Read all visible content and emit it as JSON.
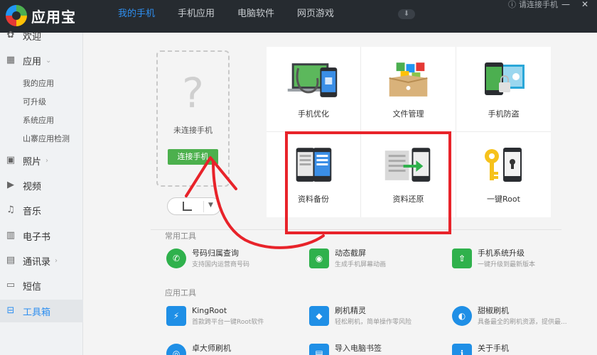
{
  "app": {
    "name": "应用宝"
  },
  "nav": {
    "tabs": [
      "我的手机",
      "手机应用",
      "电脑软件",
      "网页游戏"
    ],
    "active": 0,
    "download_icon": "download-icon"
  },
  "header_right": {
    "connect_status": "请连接手机",
    "minimize": "—",
    "close": "✕"
  },
  "sidebar": {
    "welcome": "欢迎",
    "apps": "应用",
    "app_subs": [
      "我的应用",
      "可升级",
      "系统应用",
      "山寨应用检测"
    ],
    "photos": "照片",
    "video": "视频",
    "music": "音乐",
    "ebook": "电子书",
    "contacts": "通讯录",
    "sms": "短信",
    "toolbox": "工具箱"
  },
  "phone": {
    "placeholder": "?",
    "status": "未连接手机",
    "connect_button": "连接手机"
  },
  "tiles": [
    {
      "label": "手机优化",
      "icon": "stethoscope-phone-icon"
    },
    {
      "label": "文件管理",
      "icon": "file-box-icon"
    },
    {
      "label": "手机防盗",
      "icon": "phone-lock-icon"
    },
    {
      "label": "资料备份",
      "icon": "backup-phones-icon"
    },
    {
      "label": "资料还原",
      "icon": "restore-arrow-icon"
    },
    {
      "label": "一键Root",
      "icon": "key-lock-phone-icon"
    }
  ],
  "common_tools": {
    "title": "常用工具",
    "items": [
      {
        "name": "号码归属查询",
        "desc": "支持国内运营商号码",
        "color": "#2fb14c"
      },
      {
        "name": "动态截屏",
        "desc": "生成手机屏幕动画",
        "color": "#2fb14c"
      },
      {
        "name": "手机系统升级",
        "desc": "一键升级到最新版本",
        "color": "#2fb14c"
      }
    ]
  },
  "app_tools": {
    "title": "应用工具",
    "items": [
      {
        "name": "KingRoot",
        "desc": "首款跨平台一键Root软件",
        "color": "#1f8fe6"
      },
      {
        "name": "刷机精灵",
        "desc": "轻松刷机，简单操作零风险",
        "color": "#1f8fe6"
      },
      {
        "name": "甜椒刷机",
        "desc": "具备最全的刷机资源，提供最...",
        "color": "#1f8fe6"
      },
      {
        "name": "卓大师刷机",
        "desc": "",
        "color": "#1f8fe6"
      },
      {
        "name": "导入电脑书签",
        "desc": "",
        "color": "#1f8fe6"
      },
      {
        "name": "关于手机",
        "desc": "",
        "color": "#1f8fe6"
      }
    ]
  },
  "colors": {
    "topbar": "#262b30",
    "accent": "#2e8ff0",
    "connect_green": "#4cb04d",
    "annotation_red": "#e8232a"
  }
}
